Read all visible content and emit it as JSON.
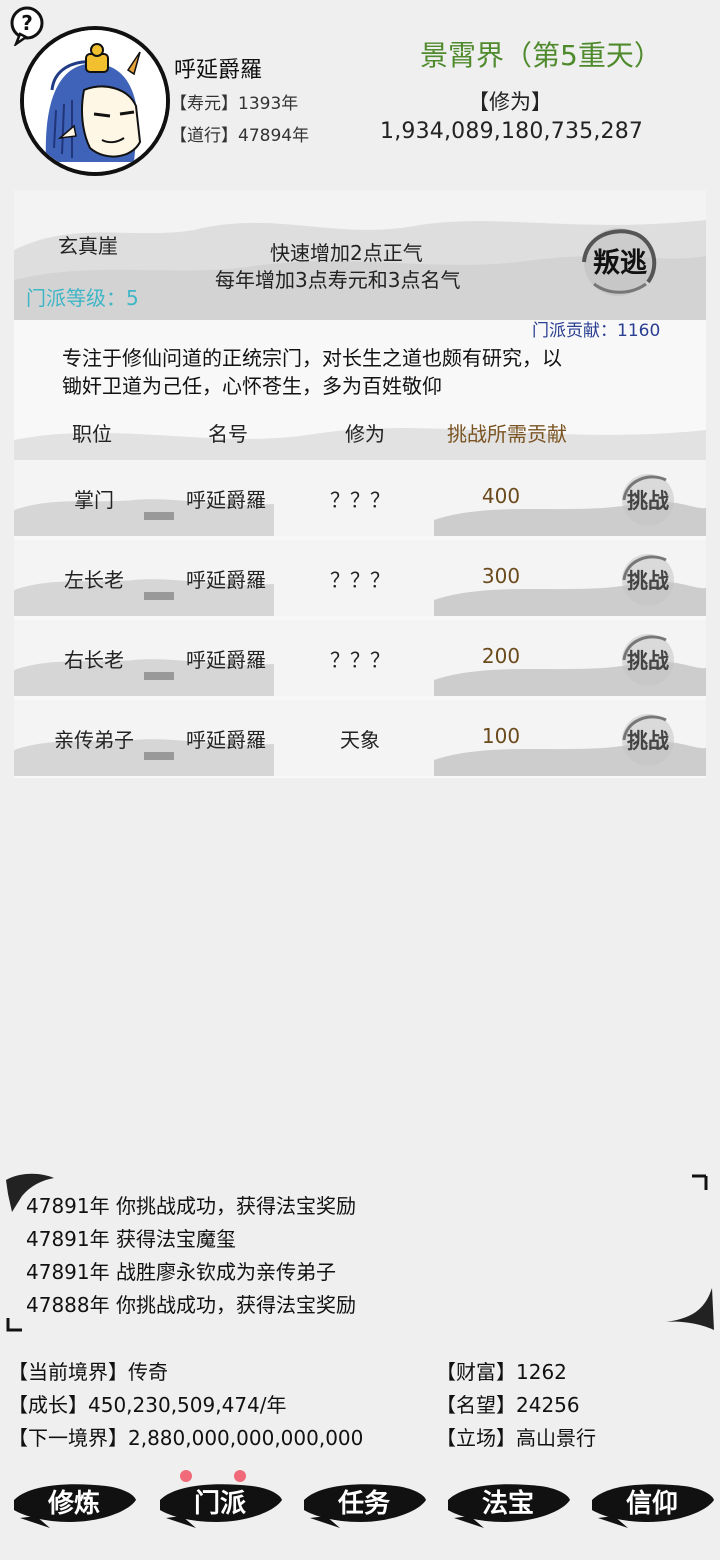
{
  "header": {
    "player_name": "呼延爵羅",
    "lifespan": "【寿元】1393年",
    "dao": "【道行】47894年",
    "realm": "景霄界（第5重天）",
    "cultivation_label": "【修为】",
    "cultivation_value": "1,934,089,180,735,287",
    "help_icon": "?"
  },
  "sect": {
    "name": "玄真崖",
    "level": "门派等级：5",
    "effect_line1": "快速增加2点正气",
    "effect_line2": "每年增加3点寿元和3点名气",
    "betray_label": "叛逃",
    "contribution": "门派贡献：1160",
    "description_line1": "专注于修仙问道的正统宗门，对长生之道也颇有研究，以",
    "description_line2": "锄奸卫道为己任，心怀苍生，多为百姓敬仰"
  },
  "table": {
    "headers": {
      "position": "职位",
      "title": "名号",
      "cultivation": "修为",
      "cost": "挑战所需贡献"
    },
    "challenge_label": "挑战",
    "rows": [
      {
        "position": "掌门",
        "name": "呼延爵羅",
        "cultivation": "？？？",
        "cost": "400"
      },
      {
        "position": "左长老",
        "name": "呼延爵羅",
        "cultivation": "？？？",
        "cost": "300"
      },
      {
        "position": "右长老",
        "name": "呼延爵羅",
        "cultivation": "？？？",
        "cost": "200"
      },
      {
        "position": "亲传弟子",
        "name": "呼延爵羅",
        "cultivation": "天象",
        "cost": "100"
      }
    ]
  },
  "log": [
    "47891年 你挑战成功，获得法宝奖励",
    "47891年 获得法宝魔玺",
    "47891年 战胜廖永钦成为亲传弟子",
    "47888年 你挑战成功，获得法宝奖励"
  ],
  "stats": {
    "current_realm": "【当前境界】传奇",
    "growth": "【成长】450,230,509,474/年",
    "next_realm": "【下一境界】2,880,000,000,000,000",
    "wealth": "【财富】1262",
    "fame": "【名望】24256",
    "stance": "【立场】高山景行"
  },
  "nav": [
    "修炼",
    "门派",
    "任务",
    "法宝",
    "信仰"
  ],
  "colors": {
    "realm": "#4f8a2d",
    "sect_level": "#3fb6c6",
    "contribution": "#2a3e92",
    "cost": "#6b4a1c"
  }
}
